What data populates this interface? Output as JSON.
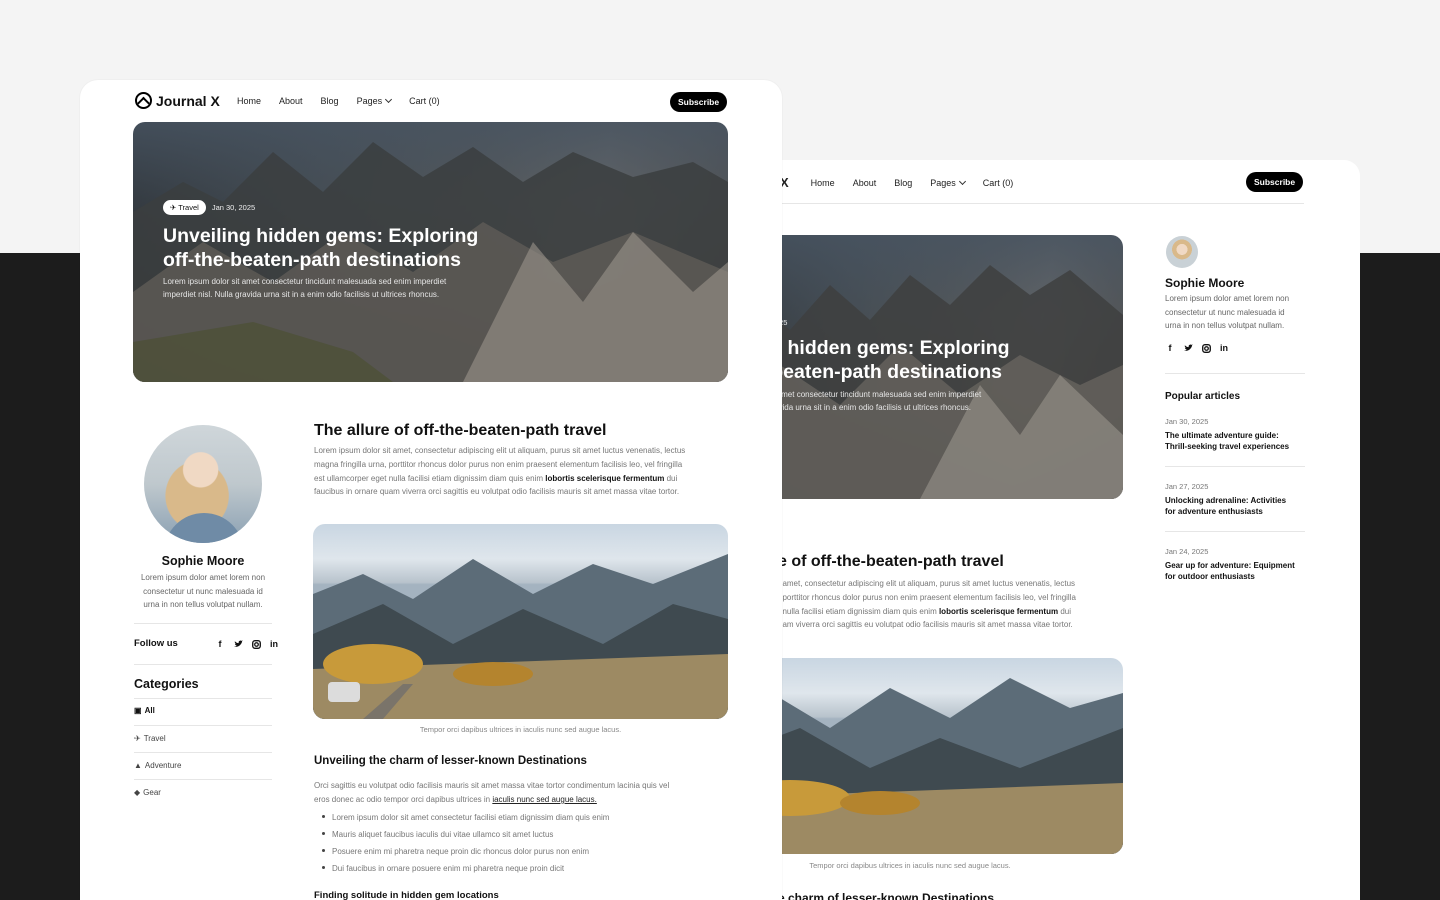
{
  "brand": {
    "name": "Journal X"
  },
  "nav": {
    "links": [
      "Home",
      "About",
      "Blog",
      "Pages",
      "Cart (0)"
    ],
    "subscribe": "Subscribe"
  },
  "hero": {
    "category": "Travel",
    "date": "Jan 30, 2025",
    "title_line1": "Unveiling hidden gems: Exploring",
    "title_line2": "off-the-beaten-path destinations",
    "back_title_line1": "iling hidden gems: Exploring",
    "back_title_line2": "he-beaten-path destinations",
    "excerpt_line1": "Lorem ipsum dolor sit amet consectetur tincidunt malesuada sed enim imperdiet",
    "excerpt_line2": "imperdiet nisl. Nulla gravida urna sit in a enim odio facilisis ut ultrices rhoncus.",
    "back_excerpt_line1": "t dolor sit amet consectetur tincidunt malesuada sed enim imperdiet",
    "back_excerpt_line2": ". Nulla gravida urna sit in a enim odio facilisis ut ultrices rhoncus."
  },
  "author": {
    "name": "Sophie Moore",
    "bio_line1": "Lorem ipsum dolor amet lorem non",
    "bio_line2": "consectetur ut nunc malesuada id",
    "bio_line3": "urna in non tellus volutpat nullam."
  },
  "follow": {
    "label": "Follow us",
    "icons": [
      "facebook-icon",
      "twitter-icon",
      "instagram-icon",
      "linkedin-icon"
    ]
  },
  "categories": {
    "title": "Categories",
    "items": [
      {
        "icon": "grid-icon",
        "label": "All"
      },
      {
        "icon": "plane-icon",
        "label": "Travel"
      },
      {
        "icon": "mountain-icon",
        "label": "Adventure"
      },
      {
        "icon": "bag-icon",
        "label": "Gear"
      }
    ]
  },
  "article": {
    "section1_title": "The allure of off-the-beaten-path travel",
    "back_section1_title": "e of off-the-beaten-path travel",
    "p1_line1": "Lorem ipsum dolor sit amet, consectetur adipiscing elit ut aliquam, purus sit amet luctus venenatis, lectus",
    "p1_line2": "magna fringilla urna, porttitor rhoncus dolor purus non enim praesent elementum facilisis leo, vel fringilla",
    "p1_line3_pre": "est ullamcorper eget nulla facilisi etiam dignissim diam quis enim ",
    "p1_bold": "lobortis scelerisque fermentum",
    "p1_line3_post": " dui",
    "p1_line4": "faucibus in ornare quam viverra orci sagittis eu volutpat odio facilisis mauris sit amet massa vitae tortor.",
    "back_p1_line1": "t amet, consectetur adipiscing elit ut aliquam, purus sit amet luctus venenatis, lectus",
    "back_p1_line2": ", porttitor rhoncus dolor purus non enim praesent elementum facilisis leo, vel fringilla",
    "back_p1_line3_pre": "t nulla facilisi etiam dignissim diam quis enim ",
    "back_p1_line4": "uam viverra orci sagittis eu volutpat odio facilisis mauris sit amet massa vitae tortor.",
    "caption": "Tempor orci dapibus ultrices in iaculis nunc sed augue lacus.",
    "section2_title": "Unveiling the charm of lesser-known Destinations",
    "back_section2_title": "e charm of lesser-known Destinations",
    "p2_line1": "Orci sagittis eu volutpat odio facilisis mauris sit amet massa vitae tortor condimentum lacinia quis vel",
    "p2_line2_pre": "eros donec ac odio tempor orci dapibus ultrices in ",
    "p2_link": "iaculis nunc sed augue lacus.",
    "bullets": [
      "Lorem ipsum dolor sit amet consectetur facilisi etiam dignissim diam quis enim",
      "Mauris aliquet faucibus iaculis dui vitae ullamco sit amet luctus",
      "Posuere enim mi pharetra neque proin dic rhoncus dolor purus non enim",
      "Dui faucibus in ornare posuere enim mi pharetra neque proin dicit"
    ],
    "section3_title": "Finding solitude in hidden gem locations"
  },
  "popular": {
    "title": "Popular articles",
    "items": [
      {
        "date": "Jan 30, 2025",
        "line1": "The ultimate adventure guide:",
        "line2": "Thrill-seeking travel experiences"
      },
      {
        "date": "Jan 27, 2025",
        "line1": "Unlocking adrenaline: Activities",
        "line2": "for adventure enthusiasts"
      },
      {
        "date": "Jan 24, 2025",
        "line1": "Gear up for adventure: Equipment",
        "line2": "for outdoor enthusiasts"
      }
    ]
  }
}
